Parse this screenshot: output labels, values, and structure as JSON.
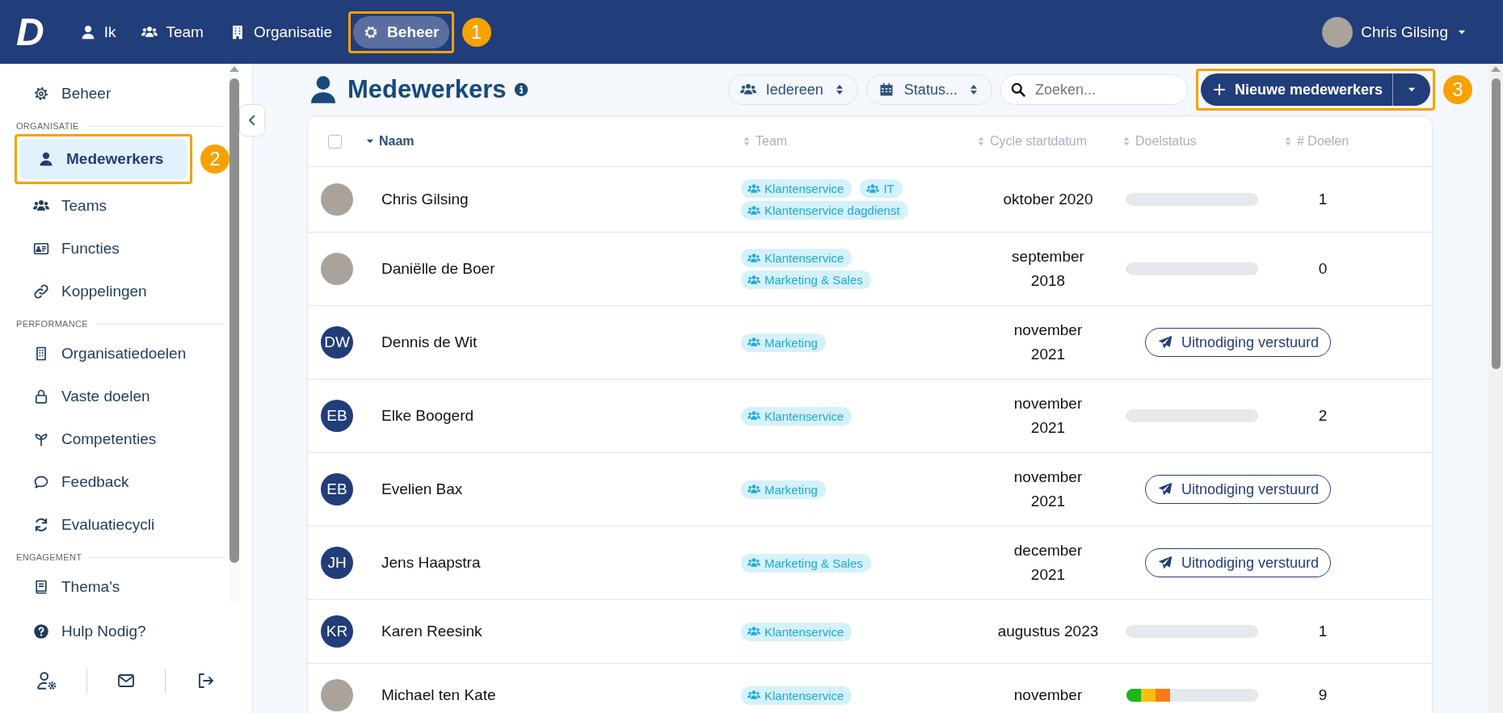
{
  "topbar": {
    "logo": "D",
    "nav": [
      {
        "label": "Ik",
        "selected": false
      },
      {
        "label": "Team",
        "selected": false
      },
      {
        "label": "Organisatie",
        "selected": false
      },
      {
        "label": "Beheer",
        "selected": true,
        "callout": "1"
      }
    ],
    "user": {
      "name": "Chris Gilsing"
    }
  },
  "sidebar": {
    "sections": [
      {
        "items": [
          {
            "label": "Beheer",
            "selected": false
          }
        ]
      },
      {
        "heading": "ORGANISATIE",
        "items": [
          {
            "label": "Medewerkers",
            "selected": true,
            "callout": "2"
          },
          {
            "label": "Teams",
            "selected": false
          },
          {
            "label": "Functies",
            "selected": false
          },
          {
            "label": "Koppelingen",
            "selected": false
          }
        ]
      },
      {
        "heading": "PERFORMANCE",
        "items": [
          {
            "label": "Organisatiedoelen",
            "selected": false
          },
          {
            "label": "Vaste doelen",
            "selected": false
          },
          {
            "label": "Competenties",
            "selected": false
          },
          {
            "label": "Feedback",
            "selected": false
          },
          {
            "label": "Evaluatiecycli",
            "selected": false
          }
        ]
      },
      {
        "heading": "ENGAGEMENT",
        "items": [
          {
            "label": "Thema's",
            "selected": false
          }
        ]
      }
    ],
    "help": {
      "label": "Hulp Nodig?"
    }
  },
  "page": {
    "title": "Medewerkers",
    "filters": [
      {
        "label": "Iedereen"
      },
      {
        "label": "Status..."
      }
    ],
    "search": {
      "placeholder": "Zoeken..."
    },
    "new_button": {
      "label": "Nieuwe medewerkers",
      "callout": "3"
    }
  },
  "table": {
    "select_all": {
      "checked": false
    },
    "columns": [
      {
        "label": "Naam",
        "sorted": true
      },
      {
        "label": "Team",
        "sorted": false
      },
      {
        "label": "Cycle startdatum",
        "sorted": false
      },
      {
        "label": "Doelstatus",
        "sorted": false
      },
      {
        "label": "# Doelen",
        "sorted": false
      }
    ],
    "rows": [
      {
        "name": "Chris Gilsing",
        "avatar": {
          "kind": "photo"
        },
        "teams": [
          "Klantenservice",
          "IT",
          "Klantenservice dagdienst"
        ],
        "cycle_start": "oktober 2020",
        "goal_status": {
          "kind": "progress",
          "level": 0
        },
        "goal_count": "1"
      },
      {
        "name": "Daniëlle de Boer",
        "avatar": {
          "kind": "photo"
        },
        "teams": [
          "Klantenservice",
          "Marketing & Sales"
        ],
        "cycle_start": "september 2018",
        "goal_status": {
          "kind": "progress",
          "level": 0
        },
        "goal_count": "0"
      },
      {
        "name": "Dennis de Wit",
        "avatar": {
          "kind": "initials",
          "initials": "DW"
        },
        "teams": [
          "Marketing"
        ],
        "cycle_start": "november 2021",
        "goal_status": {
          "kind": "invite",
          "label": "Uitnodiging verstuurd"
        }
      },
      {
        "name": "Elke Boogerd",
        "avatar": {
          "kind": "initials",
          "initials": "EB"
        },
        "teams": [
          "Klantenservice"
        ],
        "cycle_start": "november 2021",
        "goal_status": {
          "kind": "progress",
          "level": 0
        },
        "goal_count": "2"
      },
      {
        "name": "Evelien Bax",
        "avatar": {
          "kind": "initials",
          "initials": "EB"
        },
        "teams": [
          "Marketing"
        ],
        "cycle_start": "november 2021",
        "goal_status": {
          "kind": "invite",
          "label": "Uitnodiging verstuurd"
        }
      },
      {
        "name": "Jens Haapstra",
        "avatar": {
          "kind": "initials",
          "initials": "JH"
        },
        "teams": [
          "Marketing & Sales"
        ],
        "cycle_start": "december 2021",
        "goal_status": {
          "kind": "invite",
          "label": "Uitnodiging verstuurd"
        }
      },
      {
        "name": "Karen Reesink",
        "avatar": {
          "kind": "initials",
          "initials": "KR"
        },
        "teams": [
          "Klantenservice"
        ],
        "cycle_start": "augustus 2023",
        "goal_status": {
          "kind": "progress",
          "level": 0
        },
        "goal_count": "1"
      },
      {
        "name": "Michael ten Kate",
        "avatar": {
          "kind": "photo"
        },
        "teams": [
          "Klantenservice"
        ],
        "cycle_start": "november",
        "goal_status": {
          "kind": "progress",
          "level": 0.33,
          "segments": [
            {
              "color": "#1cb51c"
            },
            {
              "color": "#fcbf0f"
            },
            {
              "color": "#fb7a19"
            }
          ]
        },
        "goal_count": "9"
      }
    ]
  }
}
